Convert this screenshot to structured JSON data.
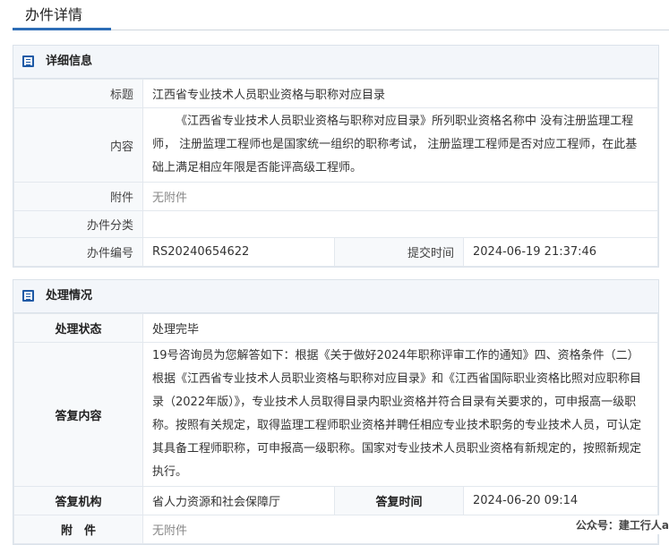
{
  "page": {
    "tab_title": "办件详情"
  },
  "detail": {
    "header": "详细信息",
    "title_label": "标题",
    "title_value": "江西省专业技术人员职业资格与职称对应目录",
    "content_label": "内容",
    "content_value": "《江西省专业技术人员职业资格与职称对应目录》所列职业资格名称中 没有注册监理工程师， 注册监理工程师也是国家统一组织的职称考试， 注册监理工程师是否对应工程师，在此基础上满足相应年限是否能评高级工程师。",
    "attachment_label": "附件",
    "attachment_value": "无附件",
    "category_label": "办件分类",
    "category_value": "",
    "number_label": "办件编号",
    "number_value": "RS20240654622",
    "submit_time_label": "提交时间",
    "submit_time_value": "2024-06-19 21:37:46"
  },
  "handling": {
    "header": "处理情况",
    "status_label": "处理状态",
    "status_value": "处理完毕",
    "reply_label": "答复内容",
    "reply_value": "19号咨询员为您解答如下：根据《关于做好2024年职称评审工作的通知》四、资格条件（二）根据《江西省专业技术人员职业资格与职称对应目录》和《江西省国际职业资格比照对应职称目录（2022年版）》，专业技术人员取得目录内职业资格并符合目录有关要求的，可申报高一级职称。按照有关规定，取得监理工程师职业资格并聘任相应专业技术职务的专业技术人员，可认定其具备工程师职称，可申报高一级职称。国家对专业技术人员职业资格有新规定的，按照新规定执行。",
    "org_label": "答复机构",
    "org_value": "省人力资源和社会保障厅",
    "reply_time_label": "答复时间",
    "reply_time_value": "2024-06-20 09:14",
    "attachment_label": "附　件",
    "attachment_value": "无附件"
  },
  "watermark": "公众号：建工行人a"
}
